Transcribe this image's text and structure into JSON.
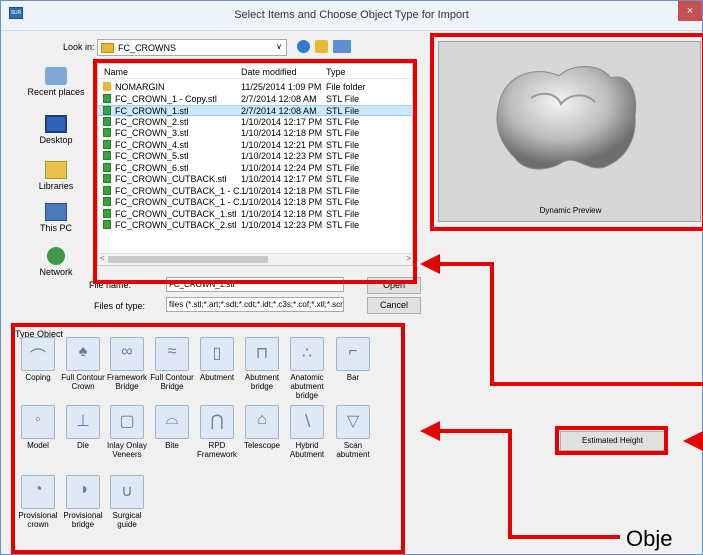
{
  "window": {
    "title": "Select Items and Choose Object Type for Import",
    "app_icon_text": "SUR",
    "close_glyph": "×"
  },
  "lookin": {
    "label": "Look in:",
    "value": "FC_CROWNS",
    "arrow": "∨"
  },
  "places": [
    {
      "label": "Recent places",
      "icon": "recent-places-icon"
    },
    {
      "label": "Desktop",
      "icon": "desktop-icon"
    },
    {
      "label": "Libraries",
      "icon": "libraries-icon"
    },
    {
      "label": "This PC",
      "icon": "computer-icon"
    },
    {
      "label": "Network",
      "icon": "network-icon"
    }
  ],
  "filelist": {
    "columns": [
      "Name",
      "Date modified",
      "Type"
    ],
    "rows": [
      {
        "name": "NOMARGIN",
        "date": "11/25/2014 1:09 PM",
        "type": "File folder",
        "kind": "folder"
      },
      {
        "name": "FC_CROWN_1 - Copy.stl",
        "date": "2/7/2014 12:08 AM",
        "type": "STL File",
        "kind": "stl"
      },
      {
        "name": "FC_CROWN_1.stl",
        "date": "2/7/2014 12:08 AM",
        "type": "STL File",
        "kind": "stl",
        "selected": true
      },
      {
        "name": "FC_CROWN_2.stl",
        "date": "1/10/2014 12:17 PM",
        "type": "STL File",
        "kind": "stl"
      },
      {
        "name": "FC_CROWN_3.stl",
        "date": "1/10/2014 12:18 PM",
        "type": "STL File",
        "kind": "stl"
      },
      {
        "name": "FC_CROWN_4.stl",
        "date": "1/10/2014 12:21 PM",
        "type": "STL File",
        "kind": "stl"
      },
      {
        "name": "FC_CROWN_5.stl",
        "date": "1/10/2014 12:23 PM",
        "type": "STL File",
        "kind": "stl"
      },
      {
        "name": "FC_CROWN_6.stl",
        "date": "1/10/2014 12:24 PM",
        "type": "STL File",
        "kind": "stl"
      },
      {
        "name": "FC_CROWN_CUTBACK.stl",
        "date": "1/10/2014 12:17 PM",
        "type": "STL File",
        "kind": "stl"
      },
      {
        "name": "FC_CROWN_CUTBACK_1 - C...",
        "date": "1/10/2014 12:18 PM",
        "type": "STL File",
        "kind": "stl"
      },
      {
        "name": "FC_CROWN_CUTBACK_1 - C...",
        "date": "1/10/2014 12:18 PM",
        "type": "STL File",
        "kind": "stl"
      },
      {
        "name": "FC_CROWN_CUTBACK_1.stl",
        "date": "1/10/2014 12:18 PM",
        "type": "STL File",
        "kind": "stl"
      },
      {
        "name": "FC_CROWN_CUTBACK_2.stl",
        "date": "1/10/2014 12:23 PM",
        "type": "STL File",
        "kind": "stl"
      }
    ],
    "scroll_left": "<",
    "scroll_right": ">"
  },
  "form": {
    "filename_label": "File name:",
    "filename_value": "FC_CROWN_1.stl",
    "filetype_label": "Files of type:",
    "filetype_value": "files (*.stl;*.art;*.sdt;*.cdt;*.idt;*.c3s;*.cof;*.xtl;*.scn;*",
    "open_label": "Open",
    "cancel_label": "Cancel"
  },
  "preview": {
    "caption": "Dynamic Preview"
  },
  "type_object": {
    "title": "Type Object",
    "items": [
      {
        "label": "Coping",
        "icon": "coping-icon"
      },
      {
        "label": "Full Contour Crown",
        "icon": "full-contour-crown-icon"
      },
      {
        "label": "Framework Bridge",
        "icon": "framework-bridge-icon"
      },
      {
        "label": "Full Contour Bridge",
        "icon": "full-contour-bridge-icon"
      },
      {
        "label": "Abutment",
        "icon": "abutment-icon"
      },
      {
        "label": "Abutment bridge",
        "icon": "abutment-bridge-icon"
      },
      {
        "label": "Anatomic abutment bridge",
        "icon": "anatomic-abutment-bridge-icon"
      },
      {
        "label": "Bar",
        "icon": "bar-icon"
      },
      {
        "label": "Model",
        "icon": "model-icon"
      },
      {
        "label": "Die",
        "icon": "die-icon"
      },
      {
        "label": "Inlay Onlay Veneers",
        "icon": "inlay-onlay-veneers-icon"
      },
      {
        "label": "Bite",
        "icon": "bite-icon"
      },
      {
        "label": "RPD Framework",
        "icon": "rpd-framework-icon"
      },
      {
        "label": "Telescope",
        "icon": "telescope-icon"
      },
      {
        "label": "Hybrid Abutment",
        "icon": "hybrid-abutment-icon"
      },
      {
        "label": "Scan abutment",
        "icon": "scan-abutment-icon"
      },
      {
        "label": "Provisional crown",
        "icon": "provisional-crown-icon"
      },
      {
        "label": "Provisional bridge",
        "icon": "provisional-bridge-icon"
      },
      {
        "label": "Surgical guide",
        "icon": "surgical-guide-icon"
      }
    ]
  },
  "estimated_height_label": "Estimated Height",
  "annotation": {
    "caption": "Obje",
    "color": "#e60000"
  }
}
